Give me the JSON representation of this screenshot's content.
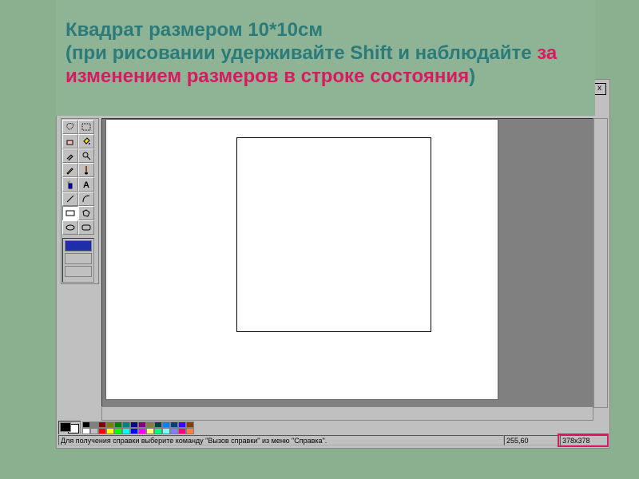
{
  "title": {
    "line1": "Квадрат размером 10*10см",
    "line2_a": "(при рисовании удерживайте Shift и наблюдайте ",
    "line2_accent": "за изменением размеров в строке состояния",
    "line2_b": ")"
  },
  "window": {
    "close": "x"
  },
  "tools": [
    {
      "name": "free-select-icon"
    },
    {
      "name": "rect-select-icon"
    },
    {
      "name": "eraser-icon"
    },
    {
      "name": "fill-icon"
    },
    {
      "name": "picker-icon"
    },
    {
      "name": "zoom-icon"
    },
    {
      "name": "pencil-icon"
    },
    {
      "name": "brush-icon"
    },
    {
      "name": "spray-icon"
    },
    {
      "name": "text-icon"
    },
    {
      "name": "line-icon"
    },
    {
      "name": "curve-icon"
    },
    {
      "name": "rect-icon",
      "selected": true
    },
    {
      "name": "polygon-icon"
    },
    {
      "name": "ellipse-icon"
    },
    {
      "name": "roundrect-icon"
    }
  ],
  "palette_row1": [
    "#000000",
    "#808080",
    "#800000",
    "#808000",
    "#008000",
    "#008080",
    "#000080",
    "#800080",
    "#808040",
    "#004040",
    "#0080FF",
    "#004080",
    "#4000FF",
    "#804000"
  ],
  "palette_row2": [
    "#FFFFFF",
    "#C0C0C0",
    "#FF0000",
    "#FFFF00",
    "#00FF00",
    "#00FFFF",
    "#0000FF",
    "#FF00FF",
    "#FFFF80",
    "#00FF80",
    "#80FFFF",
    "#8080FF",
    "#FF0080",
    "#FF8040"
  ],
  "status": {
    "help": "Для получения справки выберите команду \"Вызов справки\" из меню \"Справка\".",
    "pos": "255,60",
    "size": "378x378"
  }
}
